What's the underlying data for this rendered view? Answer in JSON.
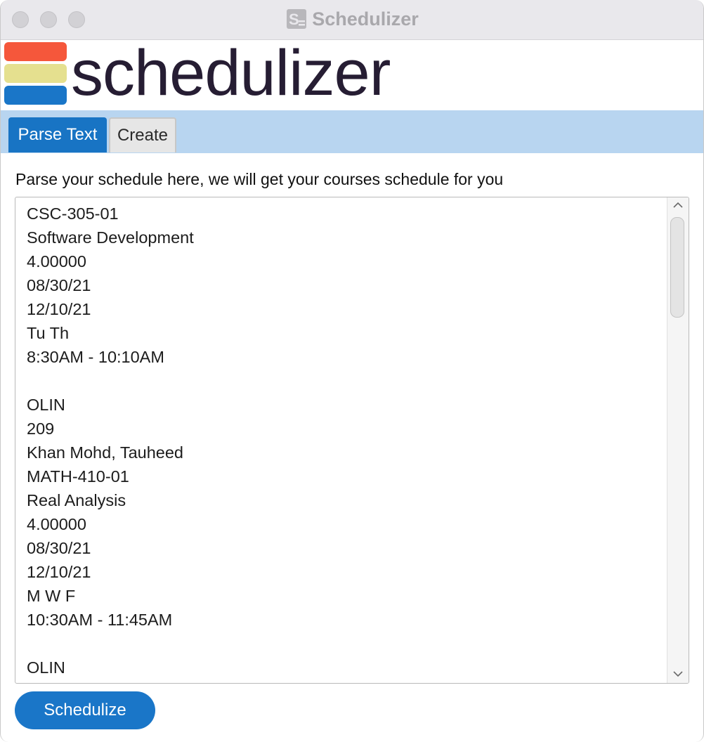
{
  "window": {
    "title": "Schedulizer"
  },
  "header": {
    "logo_text": "schedulizer",
    "logo_colors": [
      "#f5573b",
      "#e5e08f",
      "#1a76c8"
    ]
  },
  "tabs": [
    {
      "label": "Parse Text",
      "active": true
    },
    {
      "label": "Create",
      "active": false
    }
  ],
  "main": {
    "instructions": "Parse your schedule here, we will get your courses schedule for you",
    "schedule_text_lines": [
      "CSC-305-01",
      "Software Development",
      "4.00000",
      "08/30/21",
      "12/10/21",
      "Tu Th",
      "8:30AM - 10:10AM",
      "",
      "OLIN",
      "209",
      "Khan Mohd, Tauheed",
      "MATH-410-01",
      "Real Analysis",
      "4.00000",
      "08/30/21",
      "12/10/21",
      "M W F",
      "10:30AM - 11:45AM",
      "",
      "OLIN"
    ],
    "submit_label": "Schedulize"
  },
  "icons": {
    "scroll_up": "chevron-up-icon",
    "scroll_down": "chevron-down-icon",
    "app": "schedulizer-app-icon"
  }
}
